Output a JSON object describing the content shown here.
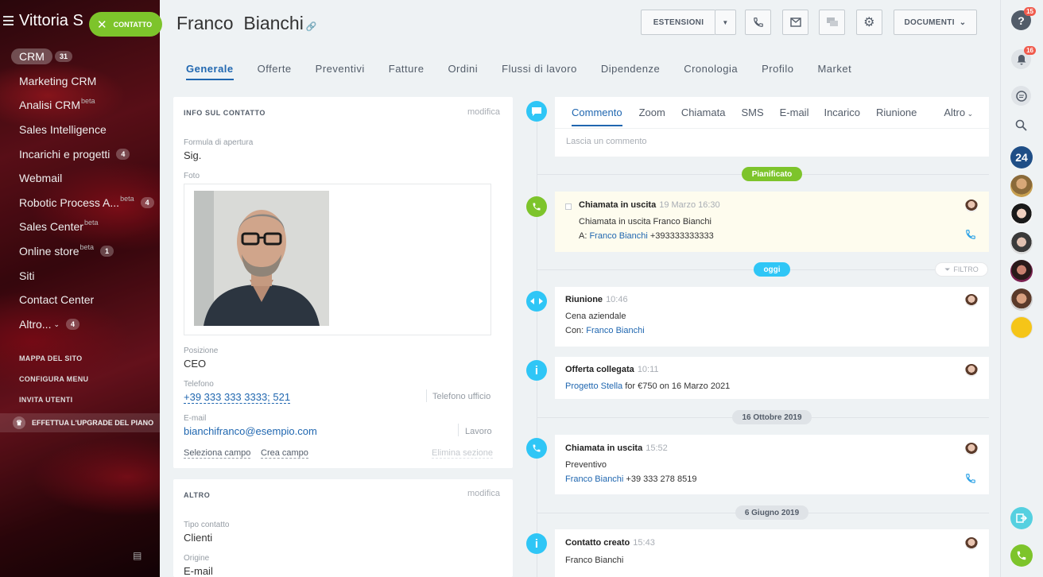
{
  "sidebar": {
    "brand": "Vittoria S",
    "contact_button": "CONTATTO",
    "crm": {
      "label": "CRM",
      "count": "31"
    },
    "items": [
      {
        "label": "Marketing CRM",
        "sup": "",
        "count": ""
      },
      {
        "label": "Analisi CRM",
        "sup": "beta",
        "count": ""
      },
      {
        "label": "Sales Intelligence",
        "sup": "",
        "count": ""
      },
      {
        "label": "Incarichi e progetti",
        "sup": "",
        "count": "4"
      },
      {
        "label": "Webmail",
        "sup": "",
        "count": ""
      },
      {
        "label": "Robotic Process A...",
        "sup": "beta",
        "count": "4"
      },
      {
        "label": "Sales Center",
        "sup": "beta",
        "count": ""
      },
      {
        "label": "Online store",
        "sup": "beta",
        "count": "1"
      },
      {
        "label": "Siti",
        "sup": "",
        "count": ""
      },
      {
        "label": "Contact Center",
        "sup": "",
        "count": ""
      },
      {
        "label": "Altro...",
        "sup": "",
        "count": "4"
      }
    ],
    "links": [
      "MAPPA DEL SITO",
      "CONFIGURA MENU",
      "INVITA UTENTI"
    ],
    "upgrade": "EFFETTUA L'UPGRADE DEL PIANO"
  },
  "header": {
    "title": "Franco  Bianchi",
    "extensions": "ESTENSIONI",
    "documents": "DOCUMENTI"
  },
  "tabs": [
    "Generale",
    "Offerte",
    "Preventivi",
    "Fatture",
    "Ordini",
    "Flussi di lavoro",
    "Dipendenze",
    "Cronologia",
    "Profilo",
    "Market"
  ],
  "contact_info": {
    "heading": "INFO SUL CONTATTO",
    "edit": "modifica",
    "salutation_label": "Formula di apertura",
    "salutation": "Sig.",
    "photo_label": "Foto",
    "position_label": "Posizione",
    "position": "CEO",
    "phone_label": "Telefono",
    "phone": "+39 333 333 3333; 521",
    "phone_type": "Telefono ufficio",
    "email_label": "E-mail",
    "email": "bianchifranco@esempio.com",
    "email_type": "Lavoro",
    "select_field": "Seleziona campo",
    "create_field": "Crea campo",
    "delete_section": "Elimina sezione"
  },
  "other": {
    "heading": "ALTRO",
    "edit": "modifica",
    "type_label": "Tipo contatto",
    "type": "Clienti",
    "source_label": "Origine",
    "source": "E-mail"
  },
  "composer": {
    "tabs": [
      "Commento",
      "Zoom",
      "Chiamata",
      "SMS",
      "E-mail",
      "Incarico",
      "Riunione",
      "Altro"
    ],
    "placeholder": "Lascia un commento"
  },
  "timeline": {
    "planned": "Pianificato",
    "today": "oggi",
    "filter": "FILTRO",
    "date1": "16 Ottobre 2019",
    "date2": "6 Giugno 2019",
    "e1": {
      "title": "Chiamata in uscita",
      "time": "19 Marzo 16:30",
      "line1": "Chiamata in uscita Franco Bianchi",
      "to_prefix": "A: ",
      "to_name": "Franco Bianchi",
      "to_number": " +393333333333"
    },
    "e2": {
      "title": "Riunione",
      "time": "10:46",
      "line1": "Cena aziendale",
      "with_prefix": "Con: ",
      "with_name": "Franco Bianchi"
    },
    "e3": {
      "title": "Offerta collegata",
      "time": "10:11",
      "link": "Progetto Stella",
      "rest": " for €750 on 16 Marzo 2021"
    },
    "e4": {
      "title": "Chiamata in uscita",
      "time": "15:52",
      "line1": "Preventivo",
      "name": "Franco Bianchi",
      "number": " +39 333 278 8519"
    },
    "e5": {
      "title": "Contatto creato",
      "time": "15:43",
      "line1": "Franco Bianchi"
    }
  },
  "rightbar": {
    "help_badge": "15",
    "notif_badge": "16",
    "logo24": "24"
  }
}
